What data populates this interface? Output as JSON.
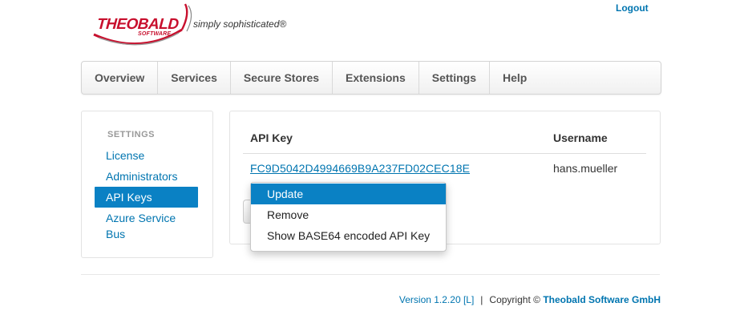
{
  "brand": {
    "wordmark": "THEOBALD",
    "sub": "SOFTWARE",
    "tagline": "simply sophisticated®",
    "accent_color": "#c8102e"
  },
  "header": {
    "logout_label": "Logout"
  },
  "nav": {
    "items": [
      {
        "label": "Overview"
      },
      {
        "label": "Services"
      },
      {
        "label": "Secure Stores"
      },
      {
        "label": "Extensions"
      },
      {
        "label": "Settings"
      },
      {
        "label": "Help"
      }
    ]
  },
  "sidebar": {
    "header": "SETTINGS",
    "items": [
      {
        "label": "License"
      },
      {
        "label": "Administrators"
      },
      {
        "label": "API Keys",
        "active": true
      },
      {
        "label": "Azure Service Bus"
      }
    ]
  },
  "table": {
    "columns": [
      "API Key",
      "Username"
    ],
    "rows": [
      {
        "api_key": "FC9D5042D4994669B9A237FD02CEC18E",
        "username": "hans.mueller"
      }
    ]
  },
  "context_menu": {
    "items": [
      {
        "label": "Update",
        "highlighted": true
      },
      {
        "label": "Remove"
      },
      {
        "label": "Show BASE64 encoded API Key"
      }
    ]
  },
  "footer": {
    "version": "Version 1.2.20 [L]",
    "separator": "|",
    "copyright_prefix": "Copyright ©",
    "company": "Theobald Software GmbH"
  },
  "colors": {
    "link": "#0075b0",
    "active_bg": "#0a81c4"
  }
}
